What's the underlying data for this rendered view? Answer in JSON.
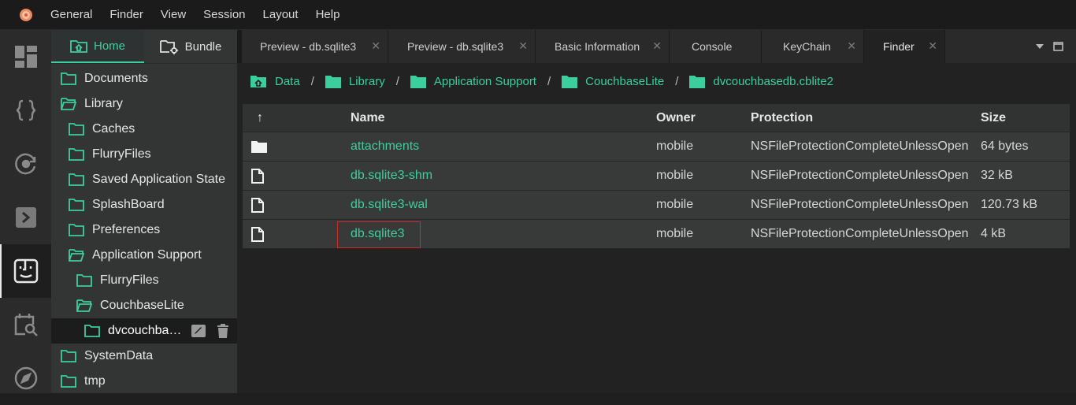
{
  "menubar": {
    "items": [
      "General",
      "Finder",
      "View",
      "Session",
      "Layout",
      "Help"
    ]
  },
  "sidebar": {
    "tabs": [
      {
        "label": "Home"
      },
      {
        "label": "Bundle"
      }
    ],
    "tree": [
      {
        "label": "Documents",
        "open": false
      },
      {
        "label": "Library",
        "open": true
      },
      {
        "label": "Caches",
        "open": false
      },
      {
        "label": "FlurryFiles",
        "open": false
      },
      {
        "label": "Saved Application State",
        "open": false
      },
      {
        "label": "SplashBoard",
        "open": false
      },
      {
        "label": "Preferences",
        "open": false
      },
      {
        "label": "Application Support",
        "open": true
      },
      {
        "label": "FlurryFiles",
        "open": false
      },
      {
        "label": "CouchbaseLite",
        "open": true
      },
      {
        "label": "dvcouchba…",
        "open": false,
        "selected": true
      },
      {
        "label": "SystemData",
        "open": false
      },
      {
        "label": "tmp",
        "open": false
      }
    ]
  },
  "tabs": [
    {
      "label": "Preview - db.sqlite3",
      "closable": true
    },
    {
      "label": "Preview - db.sqlite3",
      "closable": true
    },
    {
      "label": "Basic Information",
      "closable": true
    },
    {
      "label": "Console",
      "closable": false
    },
    {
      "label": "KeyChain",
      "closable": true
    },
    {
      "label": "Finder",
      "closable": true,
      "active": true
    }
  ],
  "breadcrumb": [
    "Data",
    "Library",
    "Application Support",
    "CouchbaseLite",
    "dvcouchbasedb.cblite2"
  ],
  "table": {
    "sort_icon": "↑",
    "columns": [
      "Name",
      "Owner",
      "Protection",
      "Size"
    ],
    "rows": [
      {
        "type": "folder",
        "name": "attachments",
        "owner": "mobile",
        "protection": "NSFileProtectionCompleteUnlessOpen",
        "size": "64 bytes"
      },
      {
        "type": "file",
        "name": "db.sqlite3-shm",
        "owner": "mobile",
        "protection": "NSFileProtectionCompleteUnlessOpen",
        "size": "32 kB"
      },
      {
        "type": "file",
        "name": "db.sqlite3-wal",
        "owner": "mobile",
        "protection": "NSFileProtectionCompleteUnlessOpen",
        "size": "120.73 kB"
      },
      {
        "type": "file",
        "name": "db.sqlite3",
        "owner": "mobile",
        "protection": "NSFileProtectionCompleteUnlessOpen",
        "size": "4 kB",
        "highlighted": true
      }
    ]
  },
  "colors": {
    "accent": "#3ccf9d",
    "highlight": "#d02a2a"
  }
}
